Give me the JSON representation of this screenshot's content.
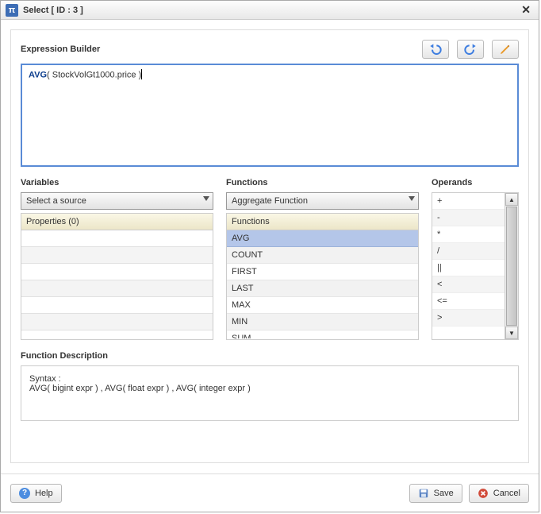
{
  "window": {
    "title": "Select [ ID : 3 ]",
    "icon_glyph": "π"
  },
  "expression": {
    "label": "Expression Builder",
    "fn": "AVG",
    "arg": "StockVolGt1000.price"
  },
  "toolbar": {
    "undo_name": "undo",
    "redo_name": "redo",
    "edit_name": "edit"
  },
  "variables": {
    "label": "Variables",
    "source_placeholder": "Select a source",
    "properties_header": "Properties (0)"
  },
  "functions": {
    "label": "Functions",
    "category": "Aggregate Function",
    "list_header": "Functions",
    "items": [
      "AVG",
      "COUNT",
      "FIRST",
      "LAST",
      "MAX",
      "MIN",
      "SUM"
    ],
    "selected": "AVG"
  },
  "operands": {
    "label": "Operands",
    "items": [
      "+",
      "-",
      "*",
      "/",
      "||",
      "<",
      "<=",
      ">"
    ]
  },
  "description": {
    "label": "Function Description",
    "syntax_label": "Syntax :",
    "syntax_text": "AVG( bigint expr ) , AVG( float expr ) , AVG( integer expr )"
  },
  "footer": {
    "help": "Help",
    "save": "Save",
    "cancel": "Cancel"
  }
}
